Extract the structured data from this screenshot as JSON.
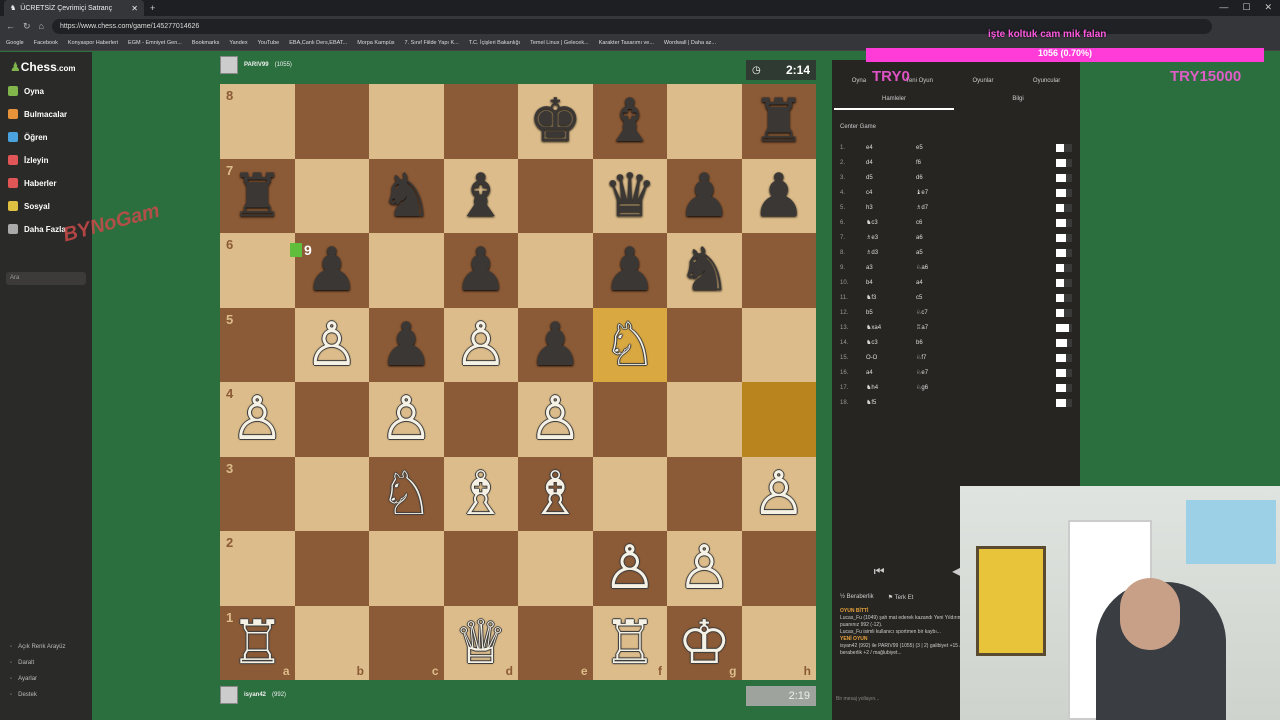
{
  "browser": {
    "tab_title": "ÜCRETSİZ Çevrimiçi Satranç",
    "url": "https://www.chess.com/game/145277014626",
    "bookmarks": [
      "Google",
      "Facebook",
      "Konyaspor Haberleri",
      "EGM - Emniyet Gen...",
      "Bookmarks",
      "Yandex",
      "YouTube",
      "EBA,Canlı Ders,EBAT...",
      "Morpa Kampüs",
      "7. Sınıf Fiilde Yapı K...",
      "T.C. İçişleri Bakanlığı",
      "Temel Linux | Gelecek...",
      "Karakter Tasarımı ve...",
      "Wordwall | Daha az..."
    ]
  },
  "sidebar": {
    "logo_text": "Chess",
    "logo_suffix": ".com",
    "items": [
      {
        "label": "Oyna",
        "color": "#81b64c"
      },
      {
        "label": "Bulmacalar",
        "color": "#e8923a"
      },
      {
        "label": "Öğren",
        "color": "#4aa3df"
      },
      {
        "label": "İzleyin",
        "color": "#e05555"
      },
      {
        "label": "Haberler",
        "color": "#e05555"
      },
      {
        "label": "Sosyal",
        "color": "#e0c040"
      },
      {
        "label": "Daha Fazla",
        "color": "#aaaaaa"
      }
    ],
    "search_placeholder": "Ara",
    "bottom": [
      "Açık Renk Arayüz",
      "Daralt",
      "Ayarlar",
      "Destek"
    ]
  },
  "watermark": "BYNoGam",
  "top_player": {
    "name": "PARIV99",
    "rating": "(1055)"
  },
  "bottom_player": {
    "name": "isyan42",
    "rating": "(992)"
  },
  "clocks": {
    "top": "2:14",
    "bottom": "2:19"
  },
  "capture_badge": "9",
  "board": {
    "rows": [
      [
        "",
        "",
        "",
        "",
        "♚",
        "♝",
        "",
        "♜"
      ],
      [
        "♜",
        "",
        "♞",
        "♝",
        "",
        "♛",
        "♟",
        "♟"
      ],
      [
        "",
        "♟",
        "",
        "♟",
        "",
        "♟",
        "♞",
        ""
      ],
      [
        "",
        "♙",
        "♟",
        "♙",
        "♟",
        "♘",
        "",
        ""
      ],
      [
        "♙",
        "",
        "♙",
        "",
        "♙",
        "",
        "",
        ""
      ],
      [
        "",
        "",
        "♘",
        "♗",
        "♗",
        "",
        "",
        "♙"
      ],
      [
        "",
        "",
        "",
        "",
        "",
        "♙",
        "♙",
        ""
      ],
      [
        "♖",
        "",
        "",
        "♕",
        "",
        "♖",
        "♔",
        ""
      ]
    ],
    "ranks": [
      "8",
      "7",
      "6",
      "5",
      "4",
      "3",
      "2",
      "1"
    ],
    "files": [
      "a",
      "b",
      "c",
      "d",
      "e",
      "f",
      "g",
      "h"
    ]
  },
  "panel": {
    "top_tabs": [
      "Oyna",
      "Yeni Oyun",
      "Oyunlar",
      "Oyuncular"
    ],
    "sub_tabs": [
      "Hamleler",
      "Bilgi"
    ],
    "opening": "Center Game",
    "moves": [
      {
        "n": "1.",
        "w": "e4",
        "b": "e5",
        "bar": 0.5
      },
      {
        "n": "2.",
        "w": "d4",
        "b": "f6",
        "bar": 0.6
      },
      {
        "n": "3.",
        "w": "d5",
        "b": "d6",
        "bar": 0.6
      },
      {
        "n": "4.",
        "w": "c4",
        "b": "♝e7",
        "bar": 0.6
      },
      {
        "n": "5.",
        "w": "h3",
        "b": "♗d7",
        "bar": 0.5
      },
      {
        "n": "6.",
        "w": "♞c3",
        "b": "c6",
        "bar": 0.6
      },
      {
        "n": "7.",
        "w": "♗e3",
        "b": "a6",
        "bar": 0.6
      },
      {
        "n": "8.",
        "w": "♗d3",
        "b": "a5",
        "bar": 0.6
      },
      {
        "n": "9.",
        "w": "a3",
        "b": "♘a6",
        "bar": 0.5
      },
      {
        "n": "10.",
        "w": "b4",
        "b": "a4",
        "bar": 0.5
      },
      {
        "n": "11.",
        "w": "♞f3",
        "b": "c5",
        "bar": 0.5
      },
      {
        "n": "12.",
        "w": "b5",
        "b": "♘c7",
        "bar": 0.5
      },
      {
        "n": "13.",
        "w": "♞xa4",
        "b": "♖a7",
        "bar": 0.8
      },
      {
        "n": "14.",
        "w": "♞c3",
        "b": "b6",
        "bar": 0.7
      },
      {
        "n": "15.",
        "w": "O-O",
        "b": "♘f7",
        "bar": 0.6
      },
      {
        "n": "16.",
        "w": "a4",
        "b": "♘e7",
        "bar": 0.6
      },
      {
        "n": "17.",
        "w": "♞h4",
        "b": "♘g6",
        "bar": 0.6
      },
      {
        "n": "18.",
        "w": "♞f5",
        "b": "",
        "bar": 0.6
      }
    ],
    "controls": [
      "⏮",
      "◀",
      "▶"
    ],
    "draw_label": "Beraberlik",
    "resign_label": "Terk Et",
    "chat": [
      {
        "head": "OYUN BİTTİ",
        "text": "Lucas_Fu (1049) şah mat ederek kazandı Yeni Yıldırım puanınız 992 (-12)."
      },
      {
        "head": "",
        "text": "Lucas_Fu isimli kullanıcı sportmen bir kaybı..."
      },
      {
        "head": "YENİ OYUN",
        "text": "isyan42 (992) ile PARIV99 (1055) (3 | 2) galibiyet +15 / beraberlik +2 / mağlubiyet..."
      }
    ],
    "chat_placeholder": "Bir mesaj yollayın..."
  },
  "stream_overlay": {
    "line1": "işte koltuk cam mik falan",
    "line2": "1056 (0.70%)",
    "left_text": "TRY0",
    "right_text": "TRY15000"
  }
}
